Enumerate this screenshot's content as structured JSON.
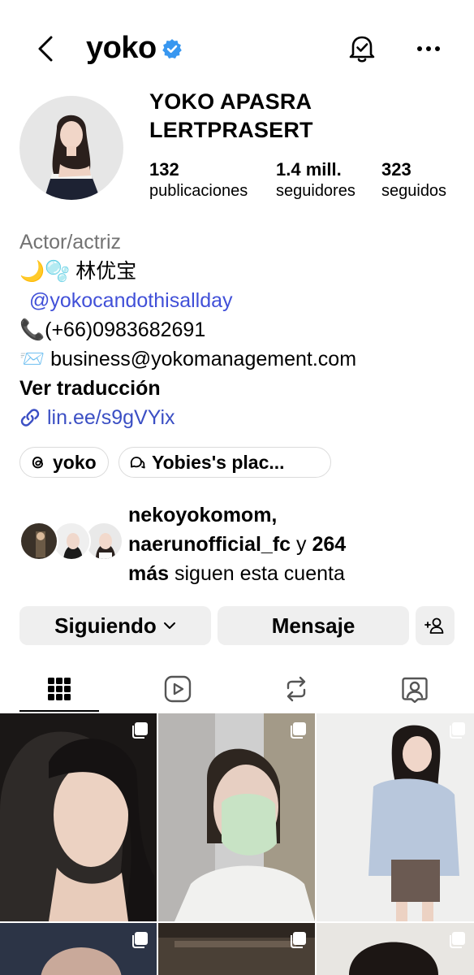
{
  "header": {
    "username": "yoko",
    "icons": {
      "back": "chevron-left-icon",
      "verified": "verified-badge-icon",
      "notifications": "bell-icon",
      "more": "more-horizontal-icon"
    },
    "verified_color": "#3897f0"
  },
  "profile": {
    "full_name": "YOKO APASRA LERTPRASERT",
    "stats": {
      "posts": {
        "value": "132",
        "label": "publicaciones"
      },
      "followers": {
        "value": "1.4 mill.",
        "label": "seguidores"
      },
      "following": {
        "value": "323",
        "label": "seguidos"
      }
    }
  },
  "bio": {
    "category": "Actor/actriz",
    "line1": "🌙🫧 林优宝",
    "mention": "@yokocandothisallday",
    "phone": "📞(+66)0983682691",
    "email": "📨 business@yokomanagement.com",
    "translate": "Ver traducción",
    "link": "lin.ee/s9gVYix",
    "link_color": "#3b4fc4"
  },
  "chips": [
    {
      "label": "yoko",
      "icon": "threads-icon"
    },
    {
      "label": "Yobies's plac...",
      "icon": "chat-bubbles-icon"
    }
  ],
  "followed_by": {
    "user1": "nekoyokomom,",
    "user2": "naerunofficial_fc",
    "connector": " y ",
    "count": "264",
    "more_word": "más",
    "suffix": " siguen esta cuenta"
  },
  "actions": {
    "following_label": "Siguiendo",
    "message_label": "Mensaje",
    "add_icon": "person-add-icon"
  },
  "tabs": [
    {
      "name": "grid",
      "icon": "grid-icon",
      "active": true
    },
    {
      "name": "reels",
      "icon": "reels-icon",
      "active": false
    },
    {
      "name": "reposts",
      "icon": "repost-icon",
      "active": false
    },
    {
      "name": "tagged",
      "icon": "tagged-icon",
      "active": false
    }
  ]
}
